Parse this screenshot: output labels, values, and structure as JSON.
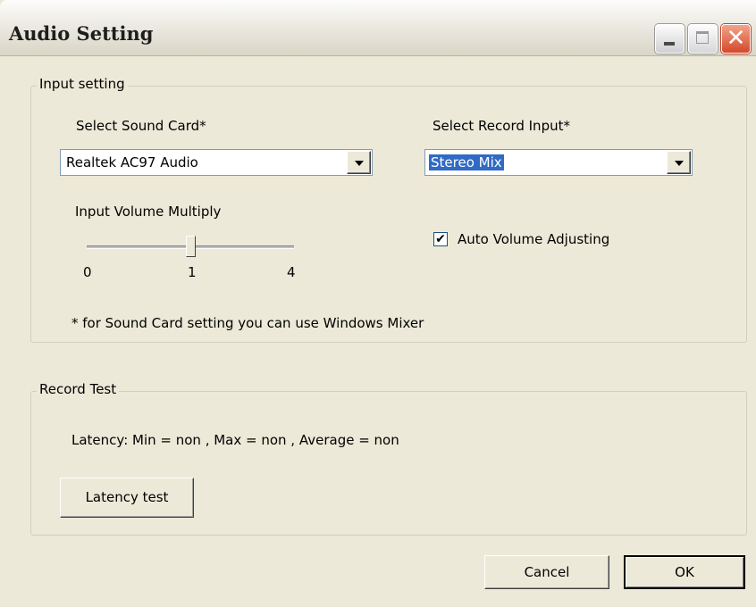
{
  "window": {
    "title": "Audio Setting",
    "close_glyph": "✕"
  },
  "input_setting": {
    "group_label": "Input setting",
    "sound_card_label": "Select Sound Card*",
    "sound_card_value": "Realtek AC97 Audio",
    "record_input_label": "Select Record Input*",
    "record_input_value": "Stereo Mix",
    "volume_label": "Input Volume Multiply",
    "slider": {
      "min_label": "0",
      "mid_label": "1",
      "max_label": "4",
      "value": 1
    },
    "auto_volume_label": "Auto Volume Adjusting",
    "auto_volume_checked": true,
    "checkmark": "✔",
    "note": "* for Sound Card setting you can use Windows Mixer"
  },
  "record_test": {
    "group_label": "Record Test",
    "latency_text": "Latency: Min = non , Max = non , Average = non",
    "latency_button": "Latency test"
  },
  "footer": {
    "cancel_label": "Cancel",
    "ok_label": "OK"
  }
}
